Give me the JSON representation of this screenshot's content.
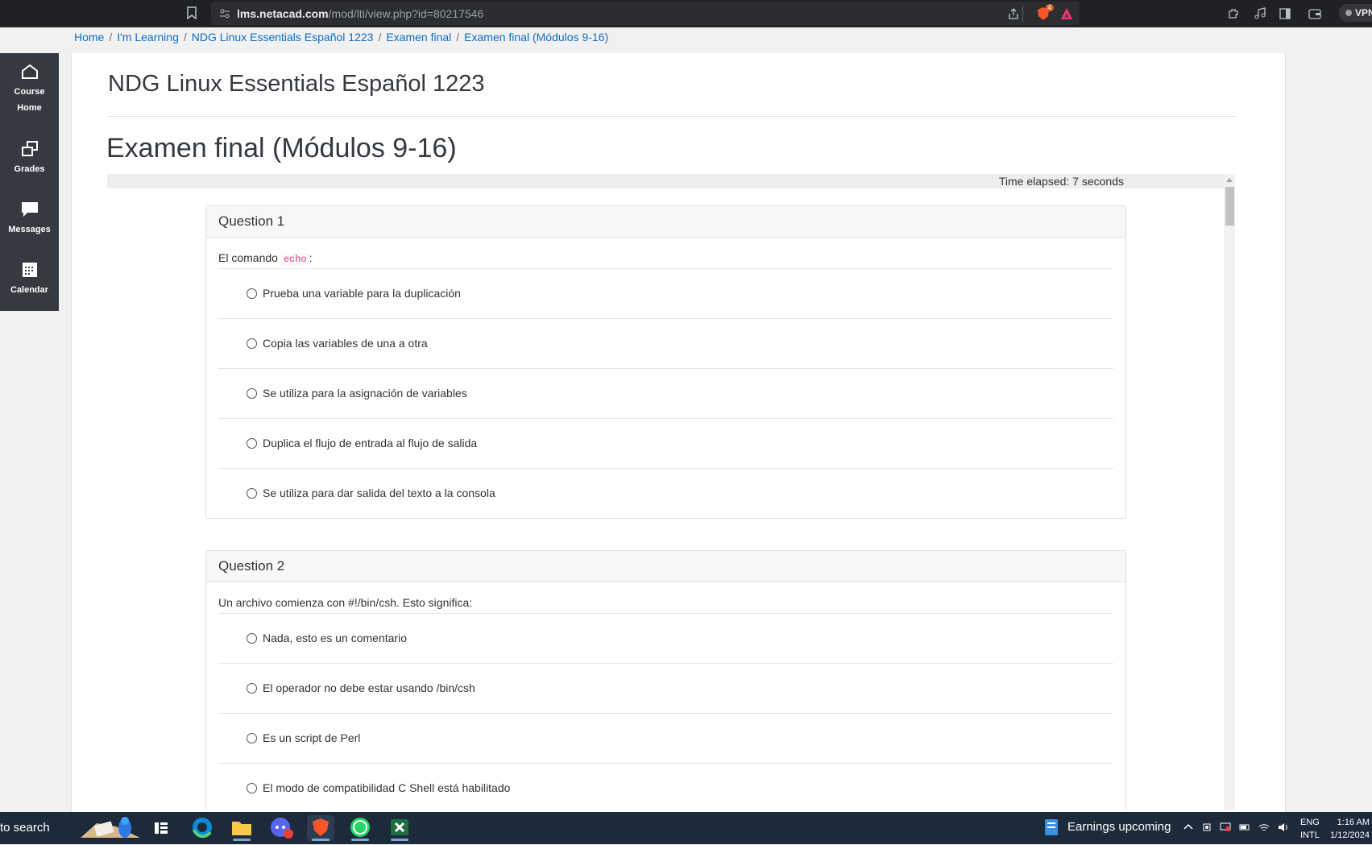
{
  "browser": {
    "url_host": "lms.netacad.com",
    "url_path": "/mod/lti/view.php?id=80217546",
    "shield_badge": "4",
    "vpn_label": "VPN"
  },
  "breadcrumb": [
    "Home",
    "I'm Learning",
    "NDG Linux Essentials Español 1223",
    "Examen final",
    "Examen final (Módulos 9-16)"
  ],
  "sidebar": {
    "items": [
      {
        "label_line1": "Course",
        "label_line2": "Home",
        "icon": "home-icon"
      },
      {
        "label_line1": "Grades",
        "label_line2": "",
        "icon": "grades-icon"
      },
      {
        "label_line1": "Messages",
        "label_line2": "",
        "icon": "messages-icon"
      },
      {
        "label_line1": "Calendar",
        "label_line2": "",
        "icon": "calendar-icon"
      }
    ]
  },
  "page": {
    "course_title": "NDG Linux Essentials Español 1223",
    "title": "Examen final (Módulos 9-16)"
  },
  "quiz": {
    "time_elapsed": "Time elapsed: 7 seconds",
    "questions": [
      {
        "header": "Question 1",
        "text_before": "El comando",
        "code": "echo",
        "text_after": ":",
        "options": [
          "Prueba una variable para la duplicación",
          "Copia las variables de una a otra",
          "Se utiliza para la asignación de variables",
          "Duplica el flujo de entrada al flujo de salida",
          "Se utiliza para dar salida del texto a la consola"
        ]
      },
      {
        "header": "Question 2",
        "text_before": "Un archivo comienza con #!/bin/csh. Esto significa:",
        "options": [
          "Nada, esto es un comentario",
          "El operador no debe estar usando /bin/csh",
          "Es un script de Perl",
          "El modo de compatibilidad C Shell está habilitado"
        ]
      }
    ]
  },
  "taskbar": {
    "search_text": "to search",
    "news_text": "Earnings upcoming",
    "lang_line1": "ENG",
    "lang_line2": "INTL",
    "time": "1:16 AM",
    "date": "1/12/2024",
    "brand_colors": {
      "brave": "#fb542b",
      "whatsapp": "#25d366",
      "excel": "#1d6f42",
      "edge": "#0c8ad6"
    }
  }
}
